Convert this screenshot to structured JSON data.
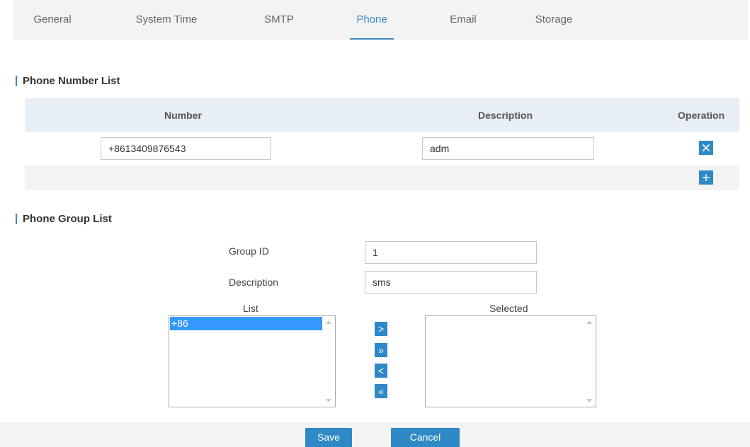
{
  "tabs": [
    {
      "label": "General",
      "active": false
    },
    {
      "label": "System Time",
      "active": false
    },
    {
      "label": "SMTP",
      "active": false
    },
    {
      "label": "Phone",
      "active": true
    },
    {
      "label": "Email",
      "active": false
    },
    {
      "label": "Storage",
      "active": false
    }
  ],
  "phone_number_list": {
    "title": "Phone Number List",
    "columns": {
      "number": "Number",
      "description": "Description",
      "operation": "Operation"
    },
    "rows": [
      {
        "number": "+8613409876543",
        "description": "adm"
      }
    ]
  },
  "phone_group_list": {
    "title": "Phone Group List",
    "group_id_label": "Group ID",
    "group_id_value": "1",
    "description_label": "Description",
    "description_value": "sms",
    "list_label": "List",
    "selected_label": "Selected",
    "list_items": [
      "+86"
    ],
    "selected_items": []
  },
  "move_buttons": {
    "add_one": ">",
    "add_all": "»",
    "remove_one": "<",
    "remove_all": "«"
  },
  "actions": {
    "save": "Save",
    "cancel": "Cancel"
  },
  "colors": {
    "accent": "#2e89c6",
    "active_tab": "#3d8ac4",
    "table_header": "#e8eef5",
    "band": "#f3f3f3"
  }
}
